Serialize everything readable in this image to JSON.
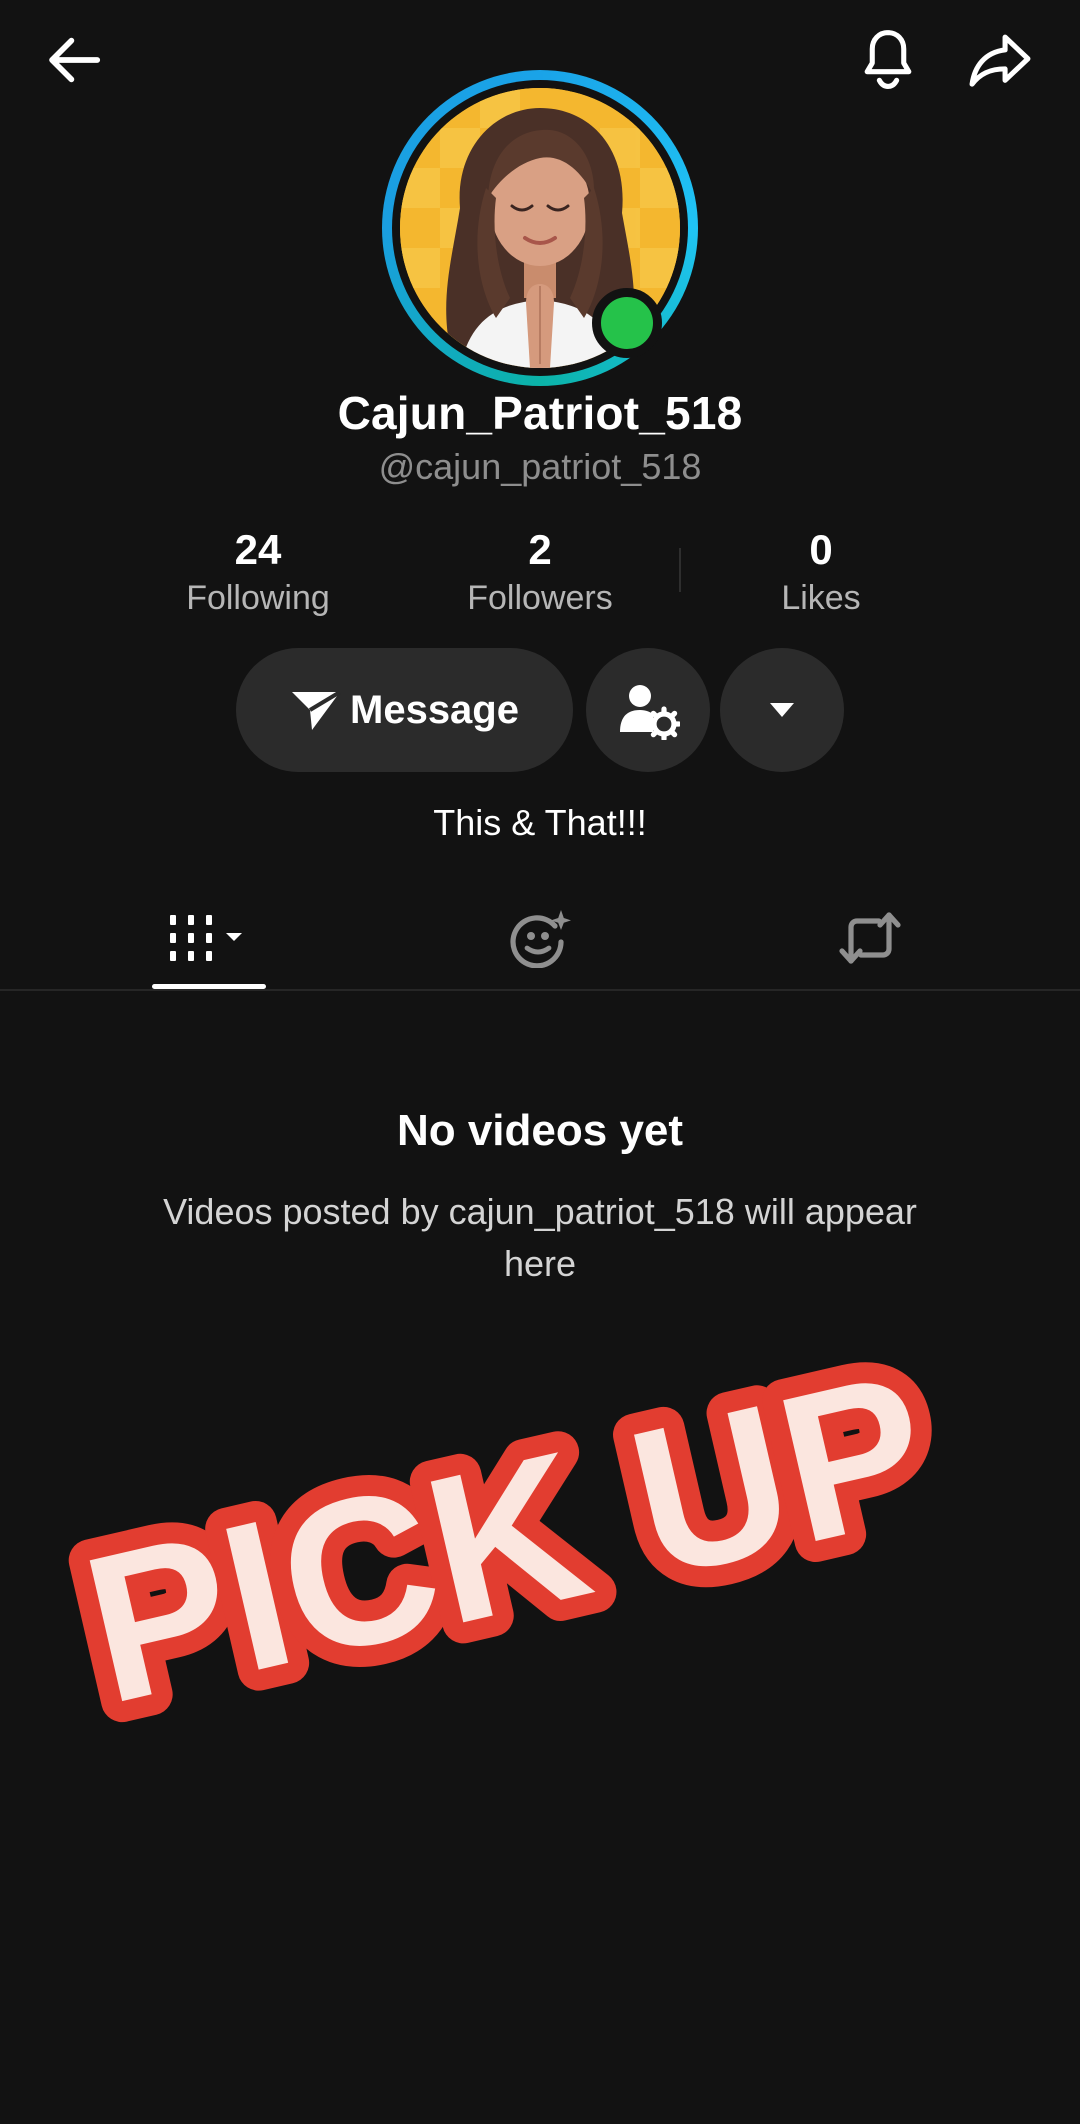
{
  "profile": {
    "display_name": "Cajun_Patriot_518",
    "username": "@cajun_patriot_518",
    "bio": "This & That!!!"
  },
  "stats": {
    "following": {
      "value": "24",
      "label": "Following"
    },
    "followers": {
      "value": "2",
      "label": "Followers"
    },
    "likes": {
      "value": "0",
      "label": "Likes"
    }
  },
  "actions": {
    "message_label": "Message"
  },
  "empty_state": {
    "title": "No videos yet",
    "description": "Videos posted by cajun_patriot_518 will appear here"
  },
  "overlay": {
    "text": "PICK UP"
  },
  "icons": {
    "back": "back-arrow-icon",
    "notifications": "bell-icon",
    "share": "share-icon",
    "message": "send-icon",
    "friend_settings": "person-settings-icon",
    "more": "caret-down-icon",
    "videos_tab": "grid-icon",
    "reposts_tab": "repost-icon",
    "face_tab": "face-sparkle-icon"
  },
  "colors": {
    "background": "#121212",
    "button": "#2b2b2b",
    "ring": "#1aa3e8",
    "online": "#25c24a",
    "sticker_red": "#e23d30",
    "sticker_fill": "#fbe6df"
  }
}
